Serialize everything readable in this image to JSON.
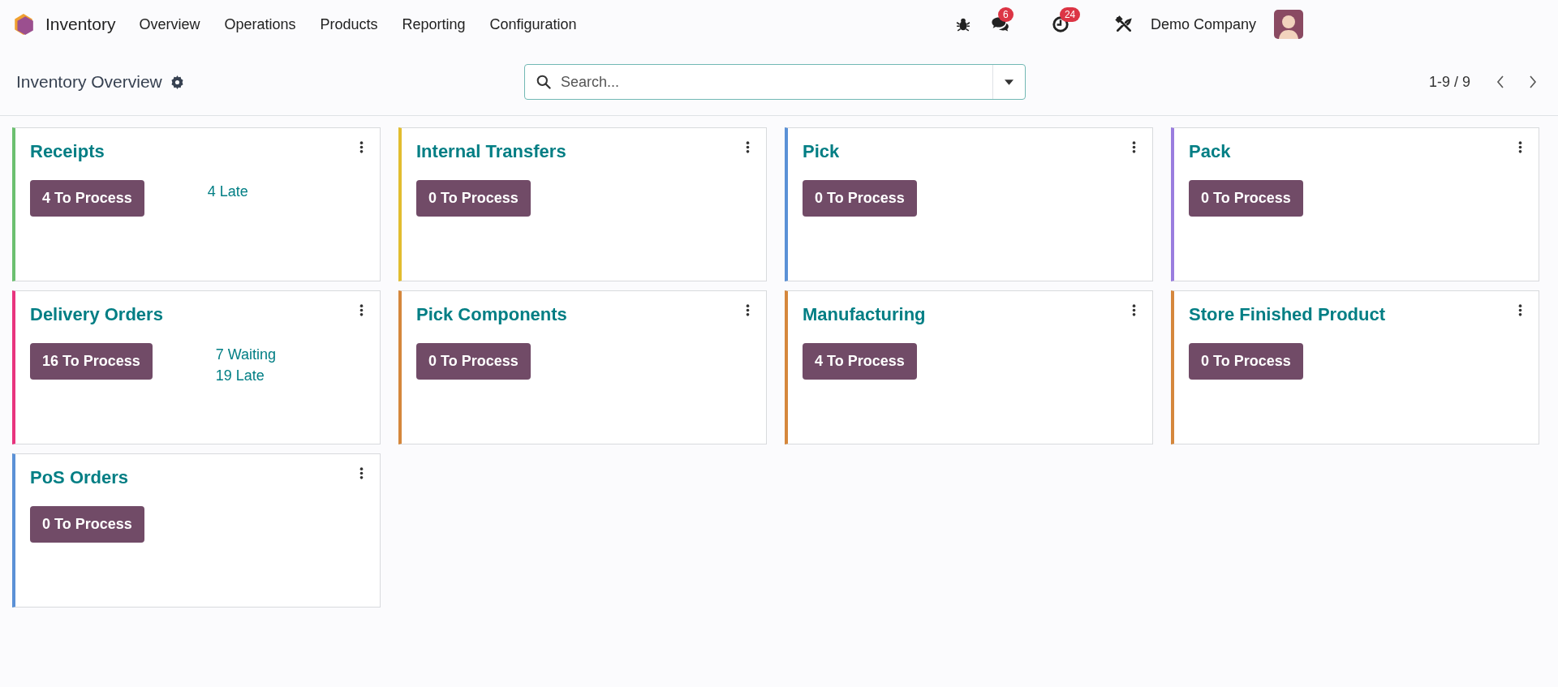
{
  "navbar": {
    "app_name": "Inventory",
    "menu": [
      "Overview",
      "Operations",
      "Products",
      "Reporting",
      "Configuration"
    ],
    "messages_badge": "6",
    "activities_badge": "24",
    "company": "Demo Company"
  },
  "control_panel": {
    "title": "Inventory Overview",
    "search": {
      "placeholder": "Search..."
    },
    "pager": "1-9 / 9"
  },
  "cards": [
    {
      "title": "Receipts",
      "color": "#6cc070",
      "button": "4 To Process",
      "stats": [
        "4 Late"
      ]
    },
    {
      "title": "Internal Transfers",
      "color": "#e2bd2f",
      "button": "0 To Process"
    },
    {
      "title": "Pick",
      "color": "#5b91d6",
      "button": "0 To Process"
    },
    {
      "title": "Pack",
      "color": "#9a7ddf",
      "button": "0 To Process"
    },
    {
      "title": "Delivery Orders",
      "color": "#e8347e",
      "button": "16 To Process",
      "stats": [
        "7 Waiting",
        "19 Late"
      ]
    },
    {
      "title": "Pick Components",
      "color": "#d5873c",
      "button": "0 To Process"
    },
    {
      "title": "Manufacturing",
      "color": "#d5873c",
      "button": "4 To Process"
    },
    {
      "title": "Store Finished Product",
      "color": "#d5873c",
      "button": "0 To Process"
    },
    {
      "title": "PoS Orders",
      "color": "#5b91d6",
      "button": "0 To Process"
    }
  ]
}
